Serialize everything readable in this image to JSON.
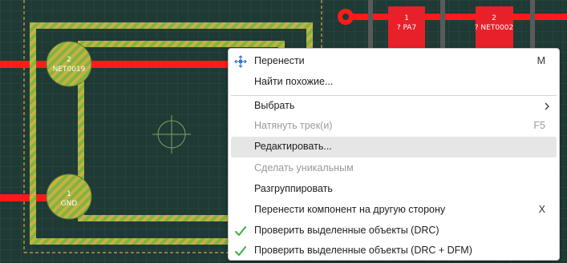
{
  "board": {
    "component_pads": [
      {
        "number": "2",
        "net": "NET0019"
      },
      {
        "number": "1",
        "net": "GND"
      }
    ],
    "smd_pads": [
      {
        "number": "1",
        "net": "? PA7"
      },
      {
        "number": "2",
        "net": "? NET0002"
      }
    ],
    "colors": {
      "background": "#1f3a35",
      "grid": "#2c4a44",
      "track": "#ff1a1a",
      "pad": "#e8202a",
      "selection_yellow": "#c9b040",
      "selection_green": "#7fb542",
      "outline_dashed": "#d9a441"
    }
  },
  "context_menu": {
    "items": [
      {
        "label": "Перенести",
        "shortcut": "M",
        "icon": "move-icon",
        "enabled": true
      },
      {
        "label": "Найти похожие...",
        "shortcut": "",
        "enabled": true
      },
      {
        "label": "Выбрать",
        "shortcut": "",
        "submenu": true,
        "enabled": true
      },
      {
        "label": "Натянуть трек(и)",
        "shortcut": "F5",
        "enabled": false
      },
      {
        "label": "Редактировать...",
        "shortcut": "",
        "enabled": true,
        "highlighted": true
      },
      {
        "label": "Сделать уникальным",
        "shortcut": "",
        "enabled": false
      },
      {
        "label": "Разгруппировать",
        "shortcut": "",
        "enabled": true
      },
      {
        "label": "Перенести компонент на другую сторону",
        "shortcut": "X",
        "enabled": true
      },
      {
        "label": "Проверить выделенные объекты (DRC)",
        "shortcut": "",
        "icon": "checkmark-icon",
        "enabled": true
      },
      {
        "label": "Проверить выделенные объекты (DRC + DFM)",
        "shortcut": "",
        "icon": "checkmark-icon",
        "enabled": true
      }
    ]
  }
}
